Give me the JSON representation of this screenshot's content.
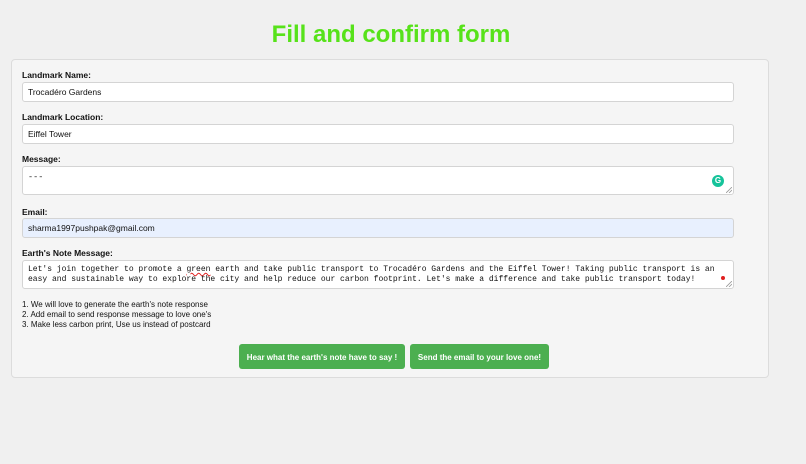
{
  "page": {
    "title": "Fill and confirm form"
  },
  "form": {
    "landmark_name": {
      "label": "Landmark Name:",
      "value": "Trocadéro Gardens"
    },
    "landmark_location": {
      "label": "Landmark Location:",
      "value": "Eiffel Tower"
    },
    "message": {
      "label": "Message:",
      "value": "---"
    },
    "email": {
      "label": "Email:",
      "value": "sharma1997pushpak@gmail.com"
    },
    "earth_note": {
      "label": "Earth's Note Message:",
      "value_part1": "Let's join together to promote a ",
      "value_misspelled": "green",
      "value_part2": " earth and take public transport to Trocadéro Gardens and the Eiffel Tower! Taking public transport is an easy and sustainable way to explore the city and help reduce our carbon footprint. Let's make a difference and take public transport today!"
    }
  },
  "notes": [
    "1. We will love to generate the earth's note response",
    "2. Add email to send response message to love one's",
    "3. Make less carbon print, Use us instead of postcard"
  ],
  "buttons": {
    "hear": "Hear what the earth's note have to say !",
    "send": "Send the email to your love one!"
  },
  "icons": {
    "grammarly_badge": "grammarly-icon",
    "grammarly_glyph": "G",
    "spellcheck_marker": "error-dot-icon"
  },
  "colors": {
    "title": "#57e21a",
    "button": "#4caf50",
    "email_autofill_bg": "#e8f0fe"
  }
}
